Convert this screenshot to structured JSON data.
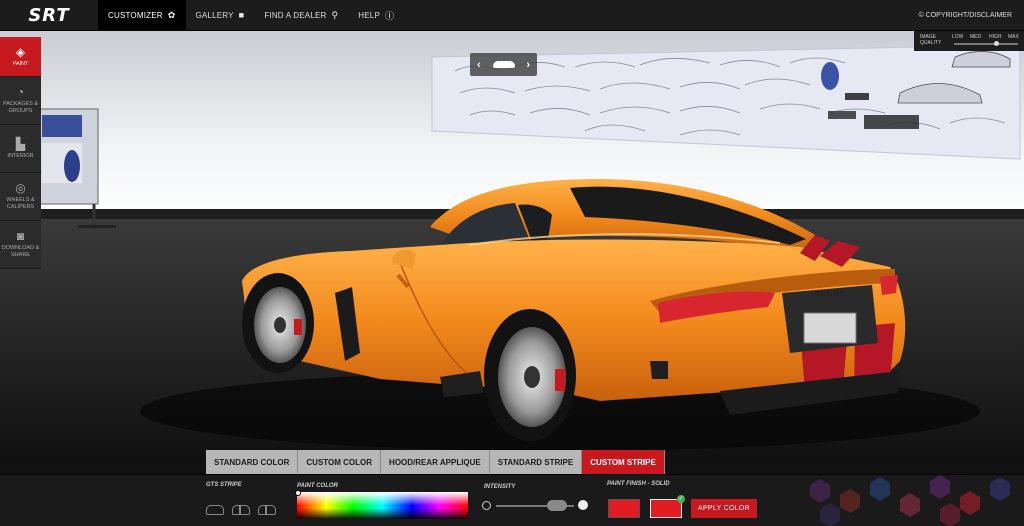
{
  "brand": {
    "logo": "SRT"
  },
  "nav": {
    "items": [
      {
        "label": "CUSTOMIZER",
        "icon": "gear-icon",
        "glyph": "✿",
        "active": true
      },
      {
        "label": "GALLERY",
        "icon": "gallery-icon",
        "glyph": "■",
        "active": false
      },
      {
        "label": "FIND A DEALER",
        "icon": "location-pin-icon",
        "glyph": "⚲",
        "active": false
      },
      {
        "label": "HELP",
        "icon": "info-icon",
        "glyph": "ⓘ",
        "active": false
      }
    ],
    "copyright": "© COPYRIGHT/DISCLAIMER"
  },
  "sidebar": {
    "items": [
      {
        "label": "PAINT",
        "icon": "paint-icon",
        "glyph": "◈",
        "active": true
      },
      {
        "label": "PACKAGES & GROUPS",
        "icon": "speedometer-icon",
        "glyph": "◔",
        "active": false
      },
      {
        "label": "INTERIOR",
        "icon": "seat-icon",
        "glyph": "▙",
        "active": false
      },
      {
        "label": "WHEELS & CALIPERS",
        "icon": "wheel-icon",
        "glyph": "◎",
        "active": false
      },
      {
        "label": "DOWNLOAD & SHARE",
        "icon": "camera-icon",
        "glyph": "◙",
        "active": false
      }
    ]
  },
  "view_nav": {
    "prev": "‹",
    "next": "›"
  },
  "image_quality": {
    "label_line1": "IMAGE",
    "label_line2": "QUALITY",
    "options": [
      "LOW",
      "MED",
      "HIGH",
      "MAX"
    ],
    "selected": "HIGH"
  },
  "car": {
    "badge": "DODGE",
    "body_color": "#f28a1c",
    "stripe_color": "#b41826"
  },
  "tabs": [
    {
      "label": "STANDARD COLOR",
      "active": false
    },
    {
      "label": "CUSTOM COLOR",
      "active": false
    },
    {
      "label": "HOOD/REAR APPLIQUE",
      "active": false
    },
    {
      "label": "STANDARD STRIPE",
      "active": false
    },
    {
      "label": "CUSTOM STRIPE",
      "active": true
    }
  ],
  "panel": {
    "gts_stripe_label": "GTS STRIPE",
    "paint_color_label": "PAINT COLOR",
    "intensity_label": "INTENSITY",
    "intensity_value": 0.78,
    "paint_finish_label": "PAINT FINISH - SOLID",
    "swatches": [
      {
        "color": "#e31b23",
        "selected": false
      },
      {
        "color": "#e31b23",
        "selected": true
      }
    ],
    "apply_label": "APPLY COLOR"
  },
  "colors": {
    "accent": "#c8191f",
    "topbar": "#1c1c1c"
  }
}
